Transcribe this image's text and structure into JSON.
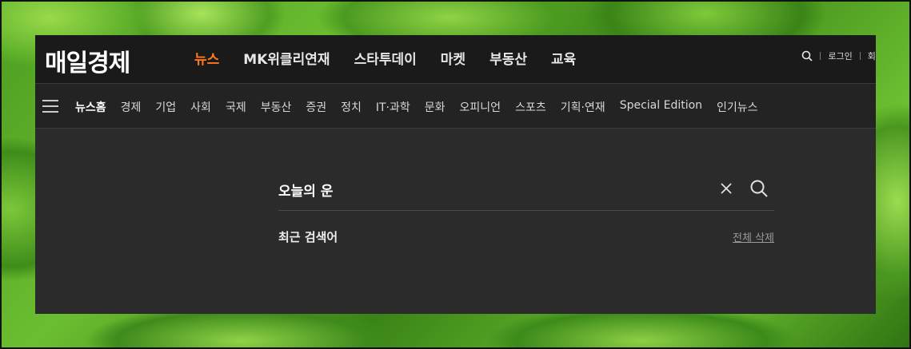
{
  "brand": {
    "logo_text": "매일경제"
  },
  "top_nav": {
    "items": [
      {
        "label": "뉴스",
        "active": true
      },
      {
        "label": "MK위클리연재",
        "active": false
      },
      {
        "label": "스타투데이",
        "active": false
      },
      {
        "label": "마켓",
        "active": false
      },
      {
        "label": "부동산",
        "active": false
      },
      {
        "label": "교육",
        "active": false
      }
    ],
    "accent_color": "#ff7a1a"
  },
  "utility": {
    "login_label": "로그인",
    "signup_label": "회원"
  },
  "category_nav": {
    "items": [
      "뉴스홈",
      "경제",
      "기업",
      "사회",
      "국제",
      "부동산",
      "증권",
      "정치",
      "IT·과학",
      "문화",
      "오피니언",
      "스포츠",
      "기획·연재",
      "Special Edition",
      "인기뉴스"
    ]
  },
  "search": {
    "query": "오늘의 운",
    "recent_label": "최근 검색어",
    "delete_all_label": "전체 삭제"
  },
  "icons": {
    "search": "search-icon",
    "clear": "close-icon",
    "menu": "hamburger-icon"
  }
}
